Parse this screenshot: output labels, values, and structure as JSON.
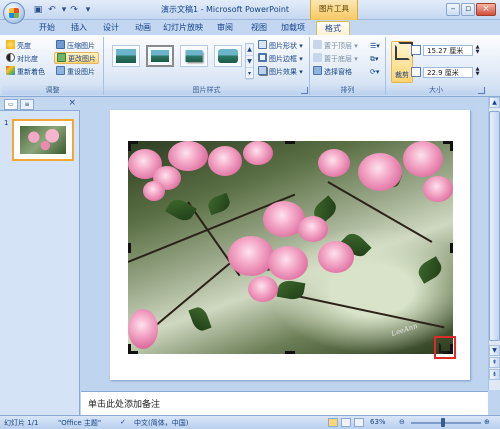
{
  "app": {
    "title": "演示文稿1 - Microsoft PowerPoint",
    "contextual_tab_group": "图片工具"
  },
  "tabs": [
    {
      "label": "开始"
    },
    {
      "label": "插入"
    },
    {
      "label": "设计"
    },
    {
      "label": "动画"
    },
    {
      "label": "幻灯片放映"
    },
    {
      "label": "审阅"
    },
    {
      "label": "视图"
    },
    {
      "label": "加载项"
    },
    {
      "label": "格式",
      "active": true
    }
  ],
  "ribbon": {
    "adjust": {
      "label": "调整",
      "buttons": [
        "亮度",
        "对比度",
        "重新着色",
        "压缩图片",
        "更改图片",
        "重设图片"
      ]
    },
    "picture_styles": {
      "label": "图片样式",
      "buttons": [
        "图片形状",
        "图片边框",
        "图片效果"
      ]
    },
    "arrange": {
      "label": "排列",
      "buttons": [
        "置于顶层",
        "置于底层",
        "选择窗格"
      ]
    },
    "size": {
      "label": "大小",
      "crop_label": "裁剪",
      "height_value": "15.27 厘米",
      "width_value": "22.9 厘米"
    }
  },
  "slides_pane": {
    "thumb_number": "1"
  },
  "slide": {
    "watermark": "LeeAnn"
  },
  "notes": {
    "placeholder": "单击此处添加备注"
  },
  "status": {
    "slide_info": "幻灯片 1/1",
    "theme": "\"Office 主题\"",
    "language": "中文(简体，中国)",
    "zoom": "63%"
  },
  "colors": {
    "ribbon_bg": "#dde8f6",
    "active_tab": "#fdf1d3",
    "highlight_box": "#e02a2a"
  }
}
